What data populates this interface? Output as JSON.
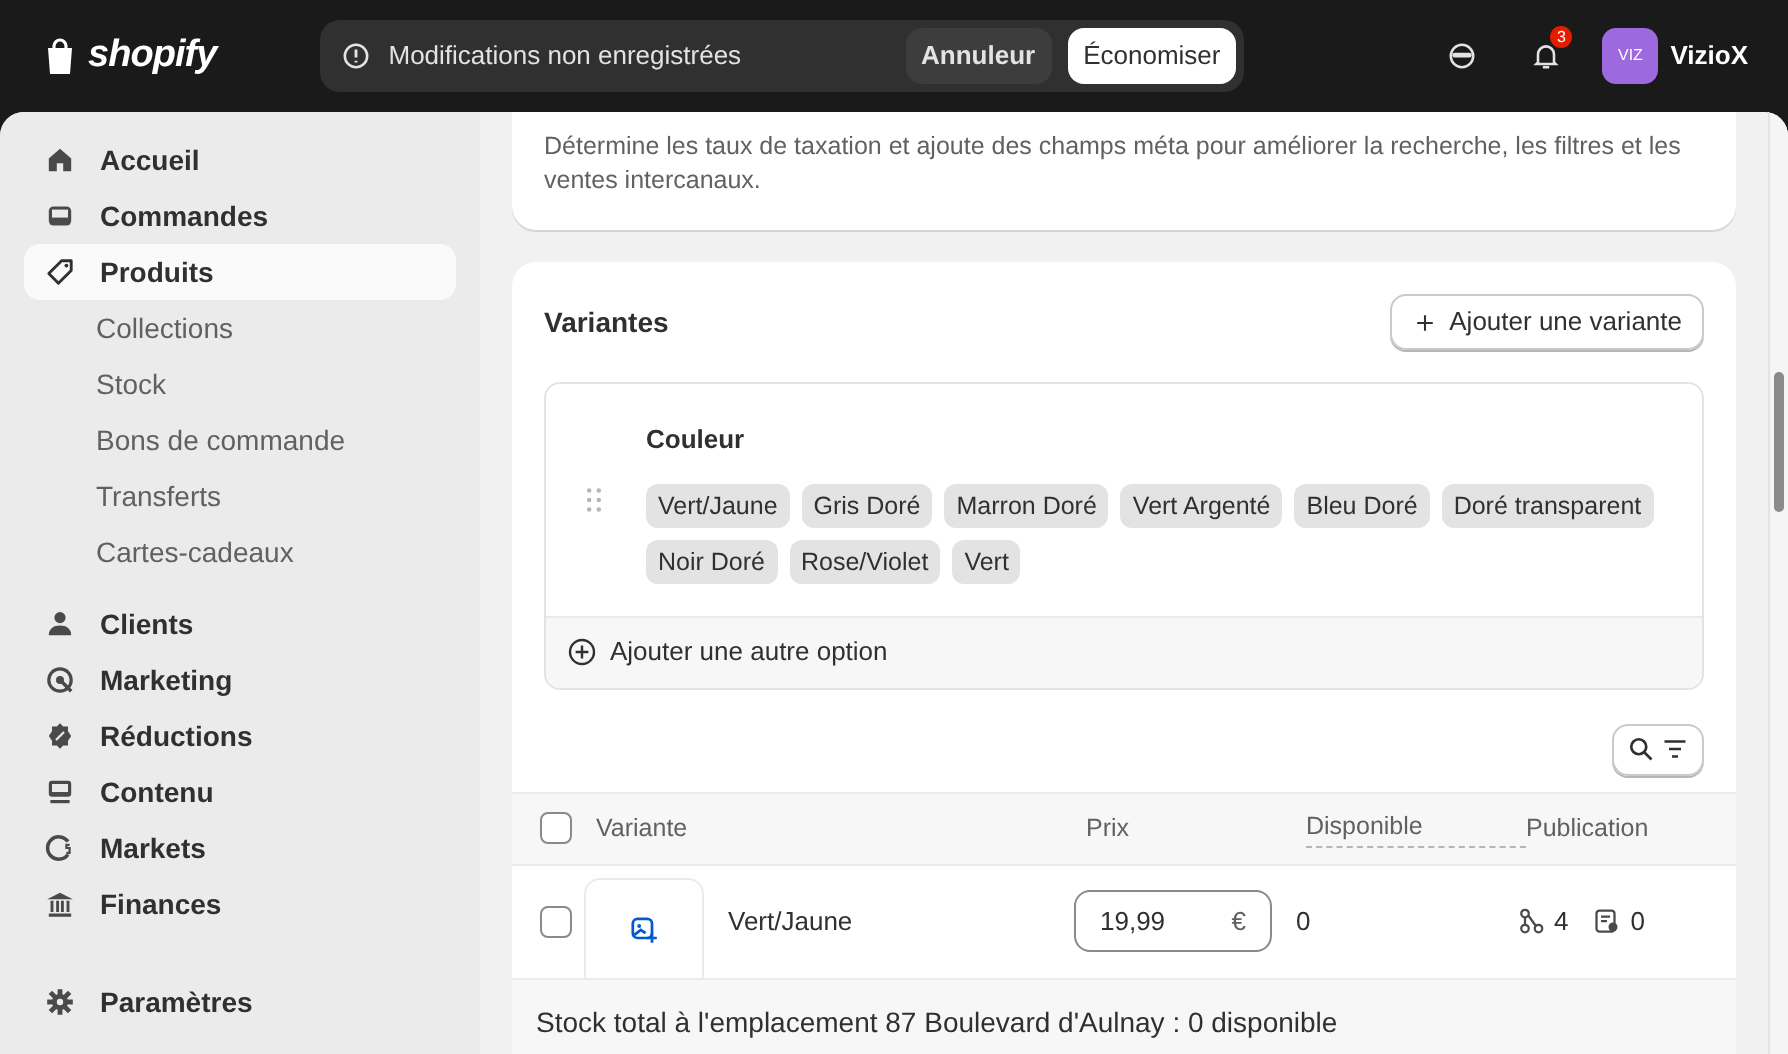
{
  "topbar": {
    "logo": "shopify",
    "unsaved_message": "Modifications non enregistrées",
    "discard_button": "Annuleur",
    "save_button": "Économiser",
    "notification_count": "3",
    "avatar_initials": "VIZ",
    "store_name": "VizioX"
  },
  "sidebar": {
    "items": [
      {
        "label": "Accueil",
        "selected": false
      },
      {
        "label": "Commandes",
        "selected": false
      },
      {
        "label": "Produits",
        "selected": true,
        "children": [
          {
            "label": "Collections"
          },
          {
            "label": "Stock"
          },
          {
            "label": "Bons de commande"
          },
          {
            "label": "Transferts"
          },
          {
            "label": "Cartes-cadeaux"
          }
        ]
      },
      {
        "label": "Clients",
        "selected": false
      },
      {
        "label": "Marketing",
        "selected": false
      },
      {
        "label": "Réductions",
        "selected": false
      },
      {
        "label": "Contenu",
        "selected": false
      },
      {
        "label": "Markets",
        "selected": false
      },
      {
        "label": "Finances",
        "selected": false
      }
    ],
    "footer_item": {
      "label": "Paramètres"
    }
  },
  "category_card": {
    "description": "Détermine les taux de taxation et ajoute des champs méta pour améliorer la recherche, les filtres et les ventes intercanaux."
  },
  "variants_card": {
    "title": "Variantes",
    "add_button": "Ajouter une variante",
    "option": {
      "name": "Couleur",
      "values": [
        "Vert/Jaune",
        "Gris Doré",
        "Marron Doré",
        "Vert Argenté",
        "Bleu Doré",
        "Doré transparent",
        "Noir Doré",
        "Rose/Violet",
        "Vert"
      ]
    },
    "add_option": "Ajouter une autre option",
    "table": {
      "select_all_checked": false,
      "columns": [
        "Variante",
        "Prix",
        "Disponible",
        "Publication"
      ],
      "rows": [
        {
          "checked": false,
          "name": "Vert/Jaune",
          "price": "19,99",
          "currency": "€",
          "available": "0",
          "channels": "4",
          "catalogs": "0"
        }
      ],
      "footer": "Stock total à l'emplacement 87 Boulevard d'Aulnay : 0 disponible"
    }
  }
}
